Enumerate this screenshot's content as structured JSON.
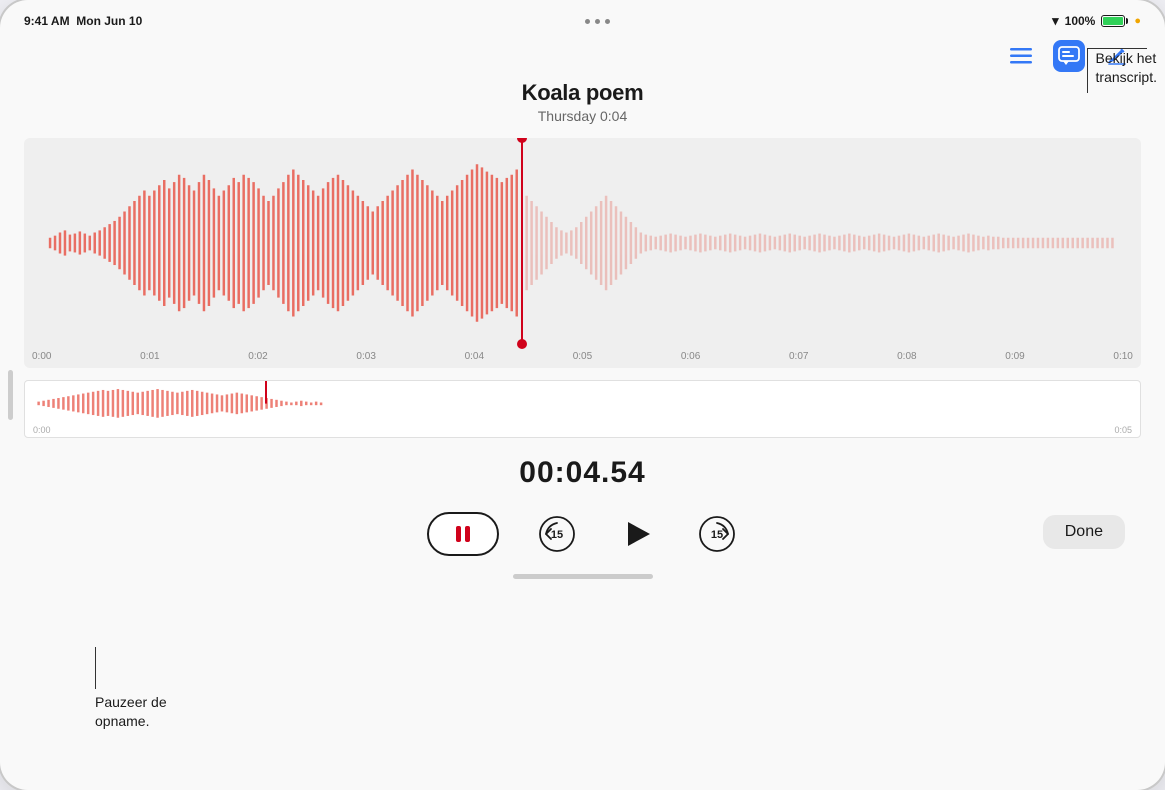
{
  "statusBar": {
    "time": "9:41 AM",
    "date": "Mon Jun 10",
    "dots": [
      "dot",
      "dot",
      "dot"
    ],
    "wifi": "100%",
    "battery": "100"
  },
  "toolbar": {
    "listIcon": "≡",
    "transcriptIcon": "💬",
    "editIcon": "✂"
  },
  "annotationTranscript": {
    "text": "Bekijk het\ntranscript."
  },
  "recording": {
    "title": "Koala poem",
    "meta": "Thursday  0:04"
  },
  "timer": {
    "display": "00:04.54"
  },
  "timeAxis": {
    "labels": [
      "0:00",
      "0:01",
      "0:02",
      "0:03",
      "0:04",
      "0:05",
      "0:06",
      "0:07",
      "0:08",
      "0:09",
      "0:10"
    ]
  },
  "miniTimeAxis": {
    "labels": [
      "0:00",
      "0:05"
    ]
  },
  "controls": {
    "pauseLabel": "pause",
    "skipBackLabel": "15",
    "playLabel": "play",
    "skipForwardLabel": "15",
    "doneLabel": "Done"
  },
  "annotationPause": {
    "text": "Pauzeer de\nopname."
  }
}
